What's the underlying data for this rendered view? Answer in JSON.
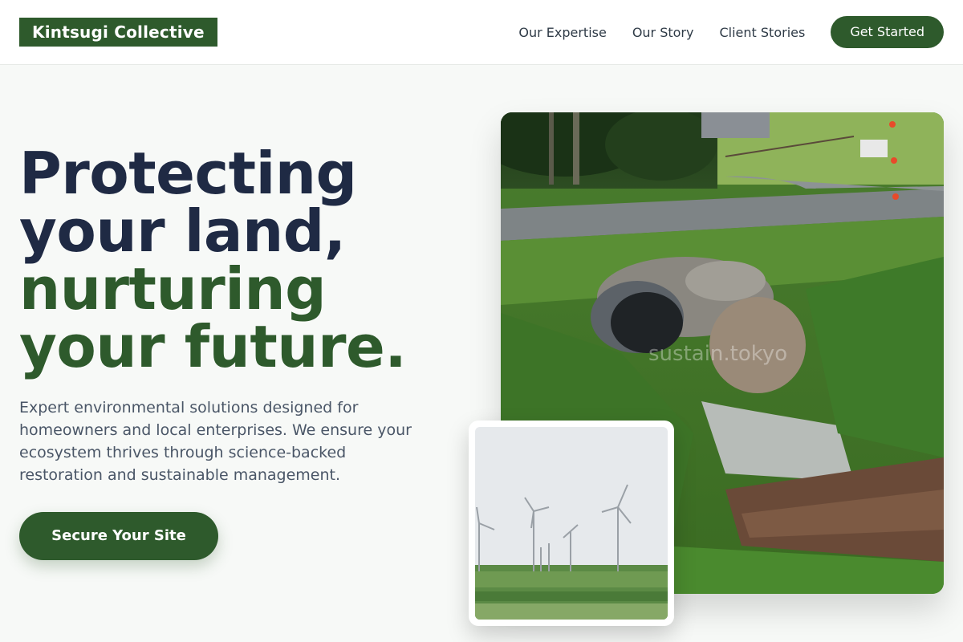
{
  "header": {
    "logo": "Kintsugi Collective",
    "nav": [
      "Our Expertise",
      "Our Story",
      "Client Stories"
    ],
    "cta": "Get Started"
  },
  "hero": {
    "headline_dark_1": "Protecting",
    "headline_dark_2": "your land,",
    "headline_green_1": "nurturing",
    "headline_green_2": "your future.",
    "description": "Expert environmental solutions designed for homeowners and local enterprises. We ensure your ecosystem thrives through science-backed restoration and sustainable management.",
    "cta": "Secure Your Site"
  },
  "images": {
    "main_watermark": "sustain.tokyo",
    "main_photo": "stream-culvert-photo",
    "inset_photo": "wind-turbines-photo"
  },
  "colors": {
    "brand_green": "#2e5a2c",
    "headline_dark": "#1f2a44",
    "body_text": "#4a5667",
    "background": "#f7f9f7"
  }
}
